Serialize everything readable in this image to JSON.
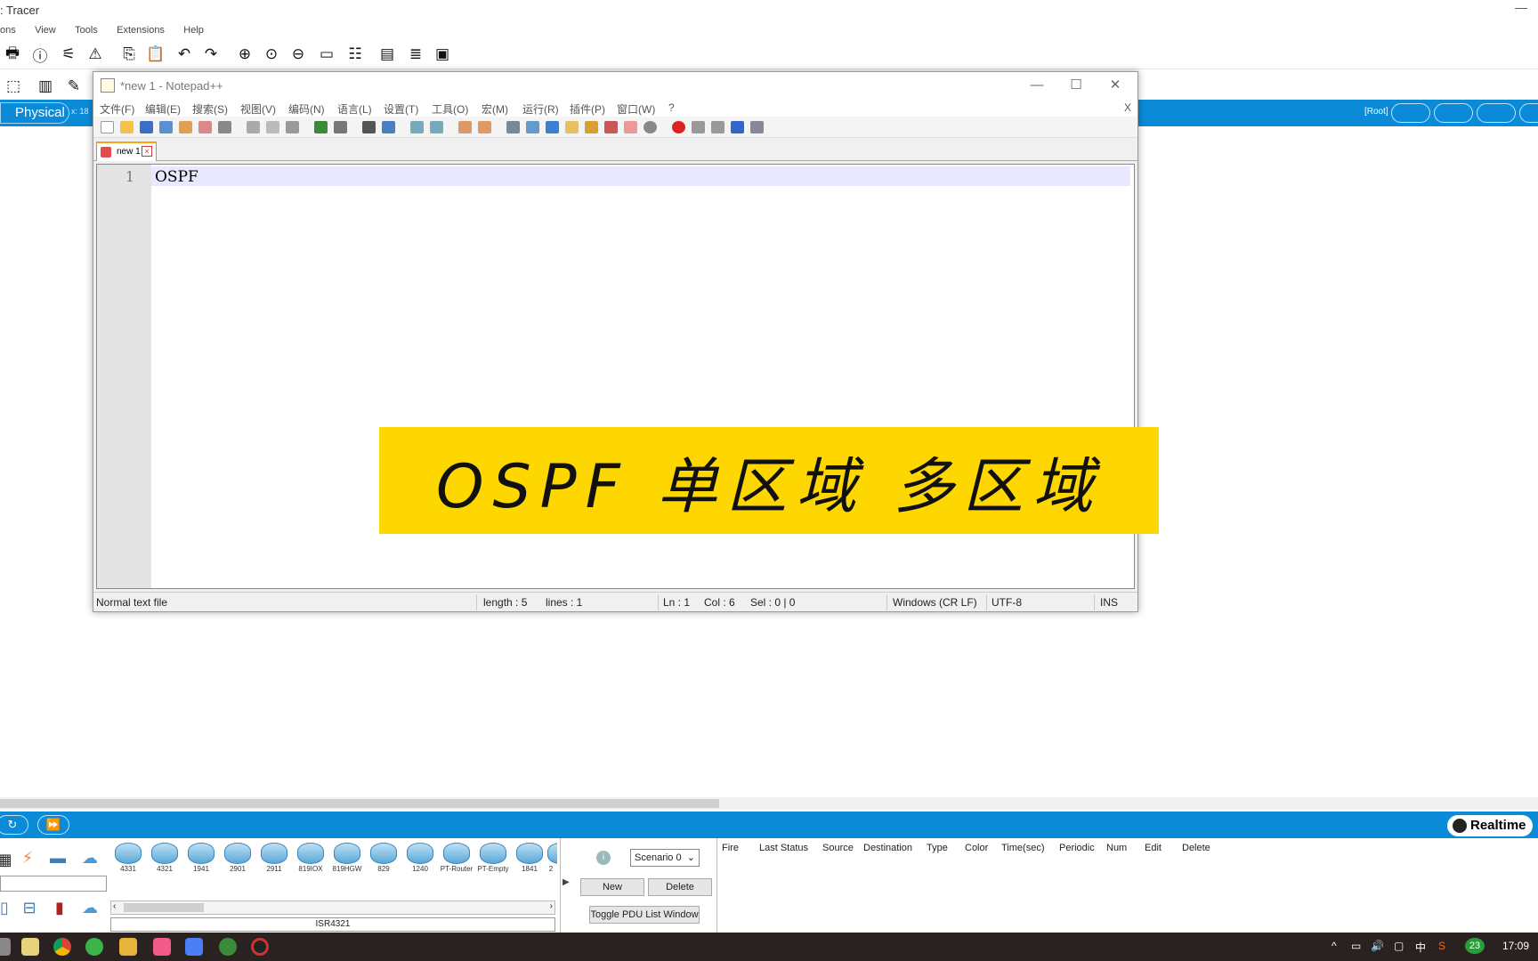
{
  "pt": {
    "title": ": Tracer",
    "menu": [
      "ons",
      "View",
      "Tools",
      "Extensions",
      "Help"
    ],
    "physical_label": "Physical",
    "coord_text": "x: 18",
    "root_label": "[Root]",
    "realtime_label": "Realtime",
    "devices": [
      "4331",
      "4321",
      "1941",
      "2901",
      "2911",
      "819IOX",
      "819HGW",
      "829",
      "1240",
      "PT-Router",
      "PT-Empty",
      "1841",
      "2"
    ],
    "selected_model": "ISR4321",
    "scenario": {
      "selected": "Scenario 0",
      "new_label": "New",
      "delete_label": "Delete",
      "toggle_label": "Toggle PDU List Window"
    },
    "pdu_columns": [
      "Fire",
      "Last Status",
      "Source",
      "Destination",
      "Type",
      "Color",
      "Time(sec)",
      "Periodic",
      "Num",
      "Edit",
      "Delete"
    ]
  },
  "npp": {
    "title": "*new 1 - Notepad++",
    "menu": [
      "文件(F)",
      "编辑(E)",
      "搜索(S)",
      "视图(V)",
      "编码(N)",
      "语言(L)",
      "设置(T)",
      "工具(O)",
      "宏(M)",
      "运行(R)",
      "插件(P)",
      "窗口(W)",
      "?"
    ],
    "menu_close": "X",
    "tab_name": "new 1",
    "line_number": "1",
    "line_text": "OSPF",
    "status": {
      "file_type": "Normal text file",
      "length": "length : 5",
      "lines": "lines : 1",
      "ln": "Ln : 1",
      "col": "Col : 6",
      "sel": "Sel : 0 | 0",
      "eol": "Windows (CR LF)",
      "encoding": "UTF-8",
      "mode": "INS"
    }
  },
  "banner": {
    "text": "OSPF 单区域 多区域"
  },
  "taskbar": {
    "ime": "中",
    "badge": "23",
    "clock": "17:09"
  },
  "colors": {
    "pt_blue": "#0b8ad8",
    "banner_yellow": "#ffd700",
    "current_line": "#e8e8ff"
  }
}
